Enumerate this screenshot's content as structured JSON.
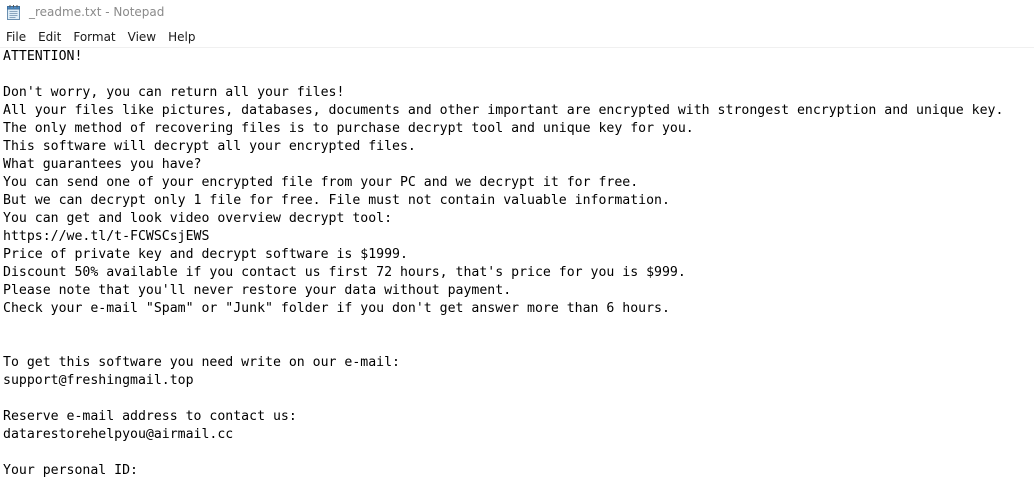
{
  "window": {
    "title": "_readme.txt - Notepad",
    "app_icon": "notepad-icon"
  },
  "menu": {
    "items": [
      "File",
      "Edit",
      "Format",
      "View",
      "Help"
    ]
  },
  "document": {
    "text": "ATTENTION!\n\nDon't worry, you can return all your files!\nAll your files like pictures, databases, documents and other important are encrypted with strongest encryption and unique key.\nThe only method of recovering files is to purchase decrypt tool and unique key for you.\nThis software will decrypt all your encrypted files.\nWhat guarantees you have?\nYou can send one of your encrypted file from your PC and we decrypt it for free.\nBut we can decrypt only 1 file for free. File must not contain valuable information.\nYou can get and look video overview decrypt tool:\nhttps://we.tl/t-FCWSCsjEWS\nPrice of private key and decrypt software is $1999.\nDiscount 50% available if you contact us first 72 hours, that's price for you is $999.\nPlease note that you'll never restore your data without payment.\nCheck your e-mail \"Spam\" or \"Junk\" folder if you don't get answer more than 6 hours.\n\n\nTo get this software you need write on our e-mail:\nsupport@freshingmail.top\n\nReserve e-mail address to contact us:\ndatarestorehelpyou@airmail.cc\n\nYour personal ID:"
  }
}
